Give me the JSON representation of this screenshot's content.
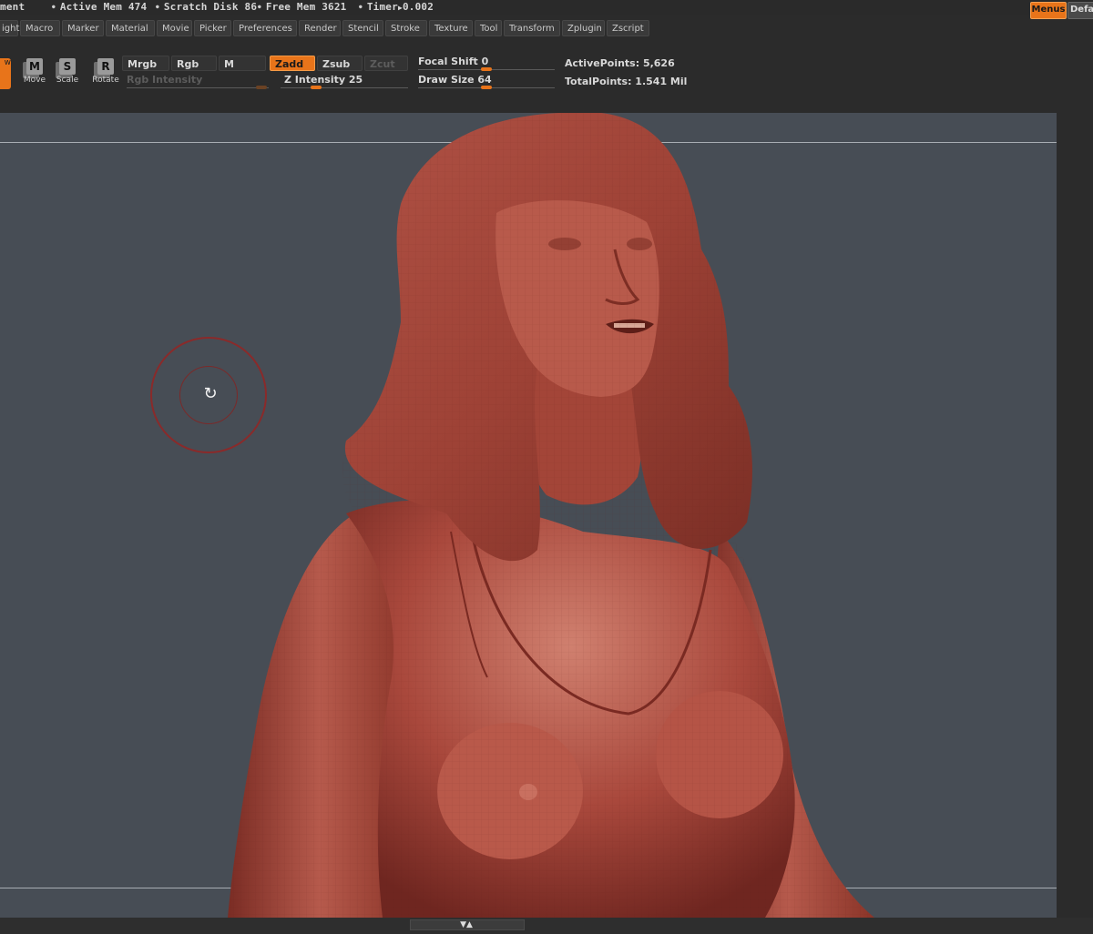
{
  "status": {
    "title_fragment": "ment",
    "active_mem": "Active Mem 474",
    "scratch_disk": "Scratch Disk 86",
    "free_mem": "Free Mem 3621",
    "timer": "Timer",
    "timer_value": "0.002",
    "menus_button": "Menus",
    "default_button": "Default"
  },
  "menu": {
    "items": [
      "ight",
      "Macro",
      "Marker",
      "Material",
      "Movie",
      "Picker",
      "Preferences",
      "Render",
      "Stencil",
      "Stroke",
      "Texture",
      "Tool",
      "Transform",
      "Zplugin",
      "Zscript"
    ]
  },
  "toolbar": {
    "draw_label": "w",
    "move": {
      "glyph": "M",
      "label": "Move"
    },
    "scale": {
      "glyph": "S",
      "label": "Scale"
    },
    "rotate": {
      "glyph": "R",
      "label": "Rotate"
    },
    "mrgb": "Mrgb",
    "rgb": "Rgb",
    "m": "M",
    "zadd": "Zadd",
    "zsub": "Zsub",
    "zcut": "Zcut",
    "rgb_intensity": "Rgb Intensity",
    "z_intensity": "Z Intensity 25",
    "z_intensity_value": 25,
    "focal_shift": "Focal Shift 0",
    "focal_shift_value": 0,
    "draw_size": "Draw Size 64",
    "draw_size_value": 64,
    "active_points": "ActivePoints: 5,626",
    "total_points": "TotalPoints: 1.541 Mil"
  },
  "colors": {
    "accent": "#e8741a",
    "viewport_bg": "#474d55",
    "model_base": "#a9483c",
    "brush_ring": "#8a2a2a"
  },
  "icons": {
    "cursor": "rotate-cursor-icon",
    "bottom": "expand-arrows-icon"
  }
}
